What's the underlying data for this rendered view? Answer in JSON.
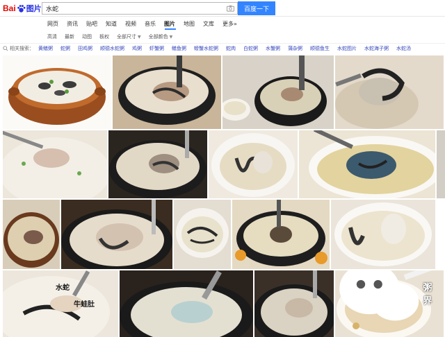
{
  "header": {
    "logo_bai": "Bai",
    "logo_tu": "图片",
    "search_value": "水蛇",
    "search_button": "百度一下"
  },
  "nav": {
    "items": [
      {
        "label": "网页",
        "active": false
      },
      {
        "label": "资讯",
        "active": false
      },
      {
        "label": "贴吧",
        "active": false
      },
      {
        "label": "知道",
        "active": false
      },
      {
        "label": "视频",
        "active": false
      },
      {
        "label": "音乐",
        "active": false
      },
      {
        "label": "图片",
        "active": true
      },
      {
        "label": "地图",
        "active": false
      },
      {
        "label": "文库",
        "active": false
      },
      {
        "label": "更多»",
        "active": false
      }
    ]
  },
  "filters": {
    "items": [
      "高清",
      "最新",
      "动图",
      "板权",
      "全部尺寸",
      "全部颜色"
    ]
  },
  "related": {
    "label": "相关搜索：",
    "items": [
      "黄鳝粥",
      "蛇粥",
      "田鸡粥",
      "顺德水蛇粥",
      "鸡粥",
      "虾蟹粥",
      "鳝鱼粥",
      "螃蟹水蛇粥",
      "蛇肉",
      "白蛇粥",
      "水蟹粥",
      "蒲杂粥",
      "顺德鱼生",
      "水蛇图片",
      "水蛇海子粥",
      "水蛇汤"
    ]
  },
  "tiles": {
    "annotation_1": "水蛇",
    "annotation_2": "牛蛙肚"
  },
  "watermark": {
    "text": "粥界"
  },
  "colors": {
    "baidu_red": "#e10601",
    "baidu_blue": "#2932e1",
    "search_button": "#3385ff",
    "link": "#3344bb"
  }
}
